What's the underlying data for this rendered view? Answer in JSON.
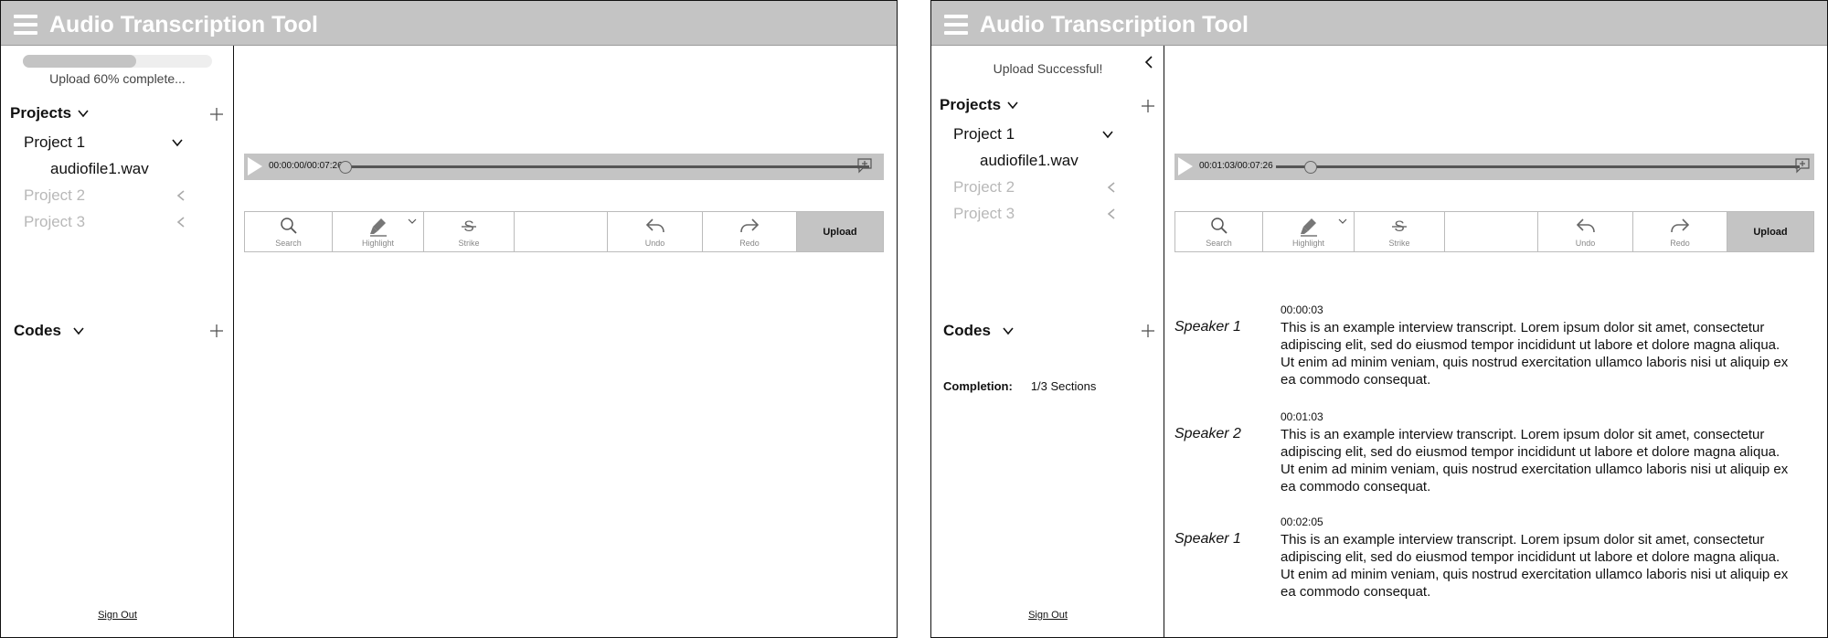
{
  "app": {
    "title": "Audio Transcription Tool"
  },
  "colors": {
    "accent_gray": "#c4c4c4",
    "dim_text": "#b8b8b8",
    "border": "#111111"
  },
  "icons": [
    "menu-icon",
    "chevron-down-icon",
    "chevron-left-icon",
    "plus-icon",
    "play-icon",
    "comment-add-icon",
    "search-icon",
    "highlight-icon",
    "strike-icon",
    "undo-icon",
    "redo-icon"
  ],
  "left": {
    "sidebar": {
      "upload_progress_value": 0.6,
      "upload_progress_text": "Upload 60% complete...",
      "projects_label": "Projects",
      "projects": [
        {
          "label": "Project 1",
          "expanded": true,
          "files": [
            "audiofile1.wav"
          ]
        },
        {
          "label": "Project 2",
          "expanded": false
        },
        {
          "label": "Project 3",
          "expanded": false
        }
      ],
      "codes_label": "Codes",
      "sign_out": "Sign Out"
    },
    "player": {
      "time": "00:00:00/00:07:26",
      "position": 0.0
    },
    "toolbar": {
      "search": "Search",
      "highlight": "Highlight",
      "strike": "Strike",
      "undo": "Undo",
      "redo": "Redo",
      "upload": "Upload"
    }
  },
  "right": {
    "sidebar": {
      "status": "Upload Successful!",
      "projects_label": "Projects",
      "projects": [
        {
          "label": "Project 1",
          "expanded": true,
          "files": [
            "audiofile1.wav"
          ]
        },
        {
          "label": "Project 2",
          "expanded": false
        },
        {
          "label": "Project 3",
          "expanded": false
        }
      ],
      "codes_label": "Codes",
      "completion_label": "Completion:",
      "completion_value": "1/3 Sections",
      "sign_out": "Sign Out"
    },
    "player": {
      "time": "00:01:03/00:07:26",
      "position": 0.0665
    },
    "toolbar": {
      "search": "Search",
      "highlight": "Highlight",
      "strike": "Strike",
      "undo": "Undo",
      "redo": "Redo",
      "upload": "Upload"
    },
    "transcript": [
      {
        "timestamp": "00:00:03",
        "speaker": "Speaker 1",
        "text": "This is an example interview transcript. Lorem ipsum dolor sit amet, consectetur adipiscing elit, sed do eiusmod tempor incididunt ut labore et dolore magna aliqua. Ut enim ad minim veniam, quis nostrud exercitation ullamco laboris nisi ut aliquip ex ea commodo consequat."
      },
      {
        "timestamp": "00:01:03",
        "speaker": "Speaker 2",
        "text": "This is an example interview transcript. Lorem ipsum dolor sit amet, consectetur adipiscing elit, sed do eiusmod tempor incididunt ut labore et dolore magna aliqua. Ut enim ad minim veniam, quis nostrud exercitation ullamco laboris nisi ut aliquip ex ea commodo consequat."
      },
      {
        "timestamp": "00:02:05",
        "speaker": "Speaker 1",
        "text": "This is an example interview transcript. Lorem ipsum dolor sit amet, consectetur adipiscing elit, sed do eiusmod tempor incididunt ut labore et dolore magna aliqua. Ut enim ad minim veniam, quis nostrud exercitation ullamco laboris nisi ut aliquip ex ea commodo consequat."
      }
    ]
  }
}
